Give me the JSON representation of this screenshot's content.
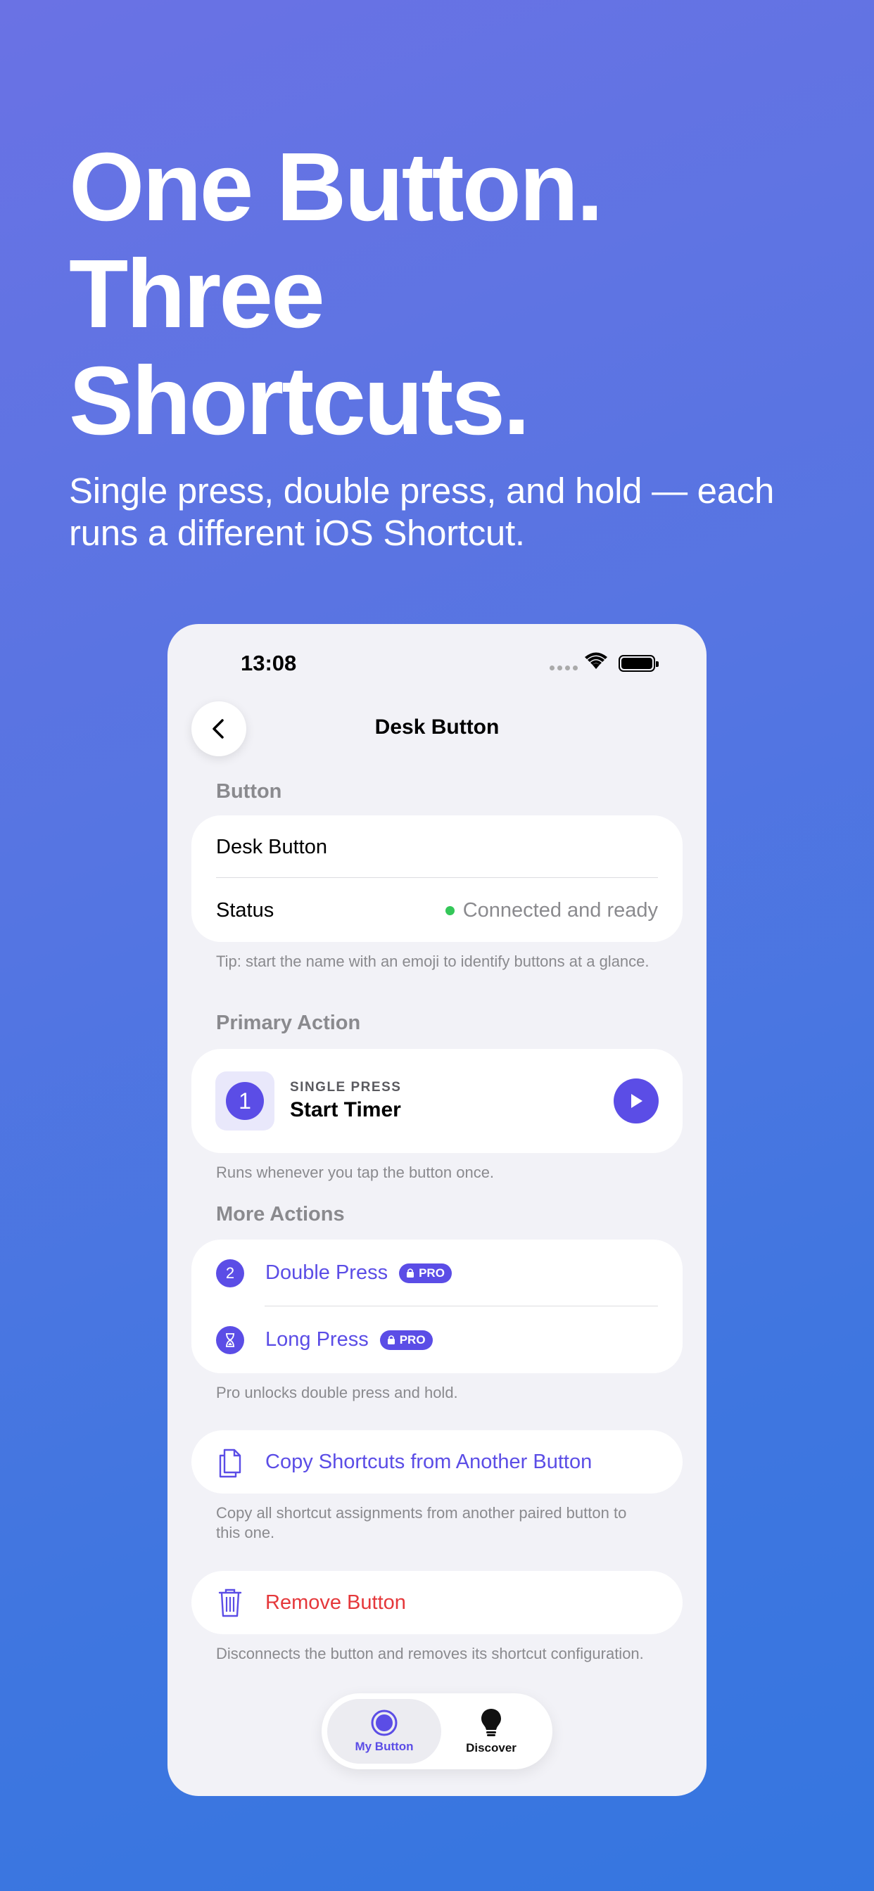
{
  "hero": {
    "headline_lines": [
      "One Button.",
      "Three",
      "Shortcuts."
    ],
    "subhead": "Single press, double press, and hold — each runs a different iOS Shortcut."
  },
  "status_bar": {
    "time": "13:08"
  },
  "nav": {
    "title": "Desk Button",
    "back_icon": "chevron-left-icon"
  },
  "button_section": {
    "label": "Button",
    "name_value": "Desk Button",
    "status_label": "Status",
    "status_value": "Connected and ready",
    "status_color": "#34c759",
    "footnote": "Tip: start the name with an emoji to identify buttons at a glance."
  },
  "primary_section": {
    "label": "Primary Action",
    "number": "1",
    "kind": "SINGLE PRESS",
    "shortcut": "Start Timer",
    "footnote": "Runs whenever you tap the button once."
  },
  "more_section": {
    "label": "More Actions",
    "items": [
      {
        "icon": "2",
        "label": "Double Press",
        "badge": "PRO"
      },
      {
        "icon": "hourglass-icon",
        "label": "Long Press",
        "badge": "PRO"
      }
    ],
    "footnote": "Pro unlocks double press and hold."
  },
  "copy_action": {
    "label": "Copy Shortcuts from Another Button",
    "footnote": "Copy all shortcut assignments from another paired button to this one."
  },
  "remove_action": {
    "label": "Remove Button",
    "footnote": "Disconnects the button and removes its shortcut configuration."
  },
  "tabbar": {
    "tabs": [
      {
        "label": "My Button",
        "icon": "button-circle-icon",
        "active": true
      },
      {
        "label": "Discover",
        "icon": "lightbulb-icon",
        "active": false
      }
    ]
  },
  "colors": {
    "accent": "#5b4de6",
    "destructive": "#e5383b",
    "background_top": "#6a72e4",
    "background_bottom": "#3576e0"
  }
}
